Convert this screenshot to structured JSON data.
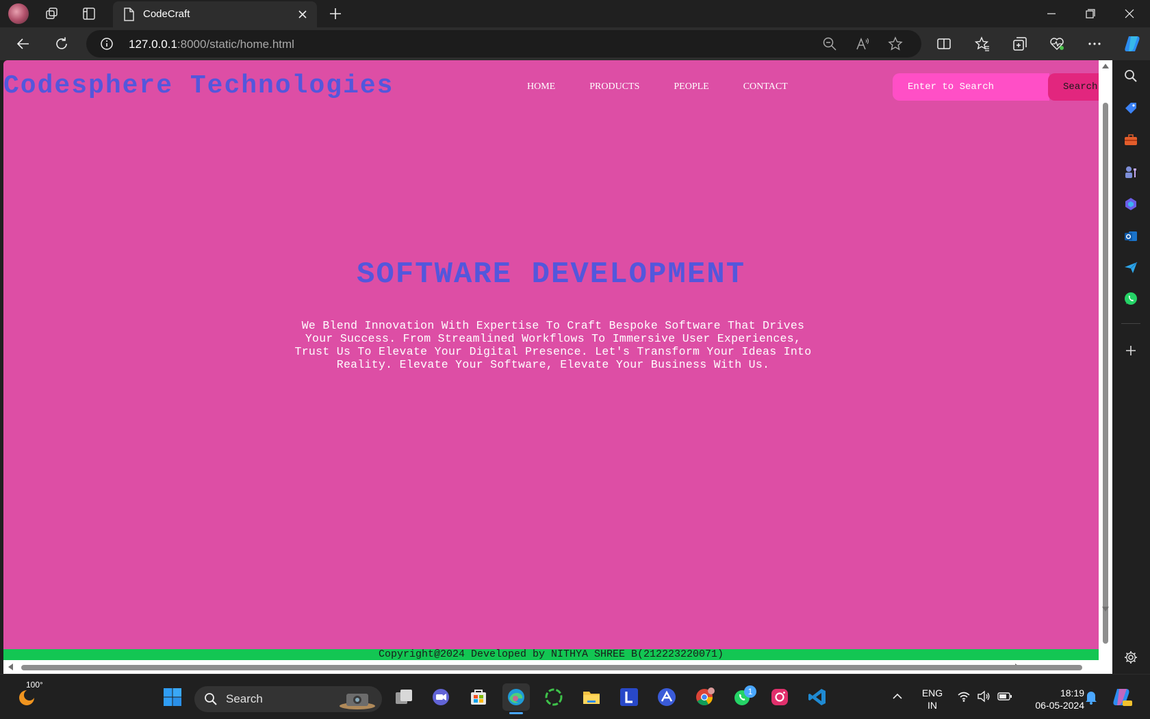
{
  "browser": {
    "tab_title": "CodeCraft",
    "url_host": "127.0.0.1",
    "url_path": ":8000/static/home.html"
  },
  "site": {
    "logo": "Codesphere Technologies",
    "nav": [
      "HOME",
      "PRODUCTS",
      "PEOPLE",
      "CONTACT"
    ],
    "search_placeholder": "Enter to Search",
    "search_button": "Search",
    "hero_title": "SOFTWARE DEVELOPMENT",
    "hero_text": "We Blend Innovation With Expertise To Craft Bespoke Software That Drives Your Success. From Streamlined Workflows To Immersive User Experiences, Trust Us To Elevate Your Digital Presence. Let's Transform Your Ideas Into Reality. Elevate Your Software, Elevate Your Business With Us.",
    "footer": "Copyright@2024 Developed by NITHYA SHREE B(212223220071)"
  },
  "colors": {
    "page_background": "#dd4ea5",
    "heading": "#5357dc",
    "search_box": "#ff4fc6",
    "search_button": "#e2267e",
    "footer": "#13c653"
  },
  "taskbar": {
    "weather_temp": "100°",
    "search_label": "Search",
    "whatsapp_badge": "1",
    "lang_line1": "ENG",
    "lang_line2": "IN",
    "time": "18:19",
    "date": "06-05-2024"
  }
}
